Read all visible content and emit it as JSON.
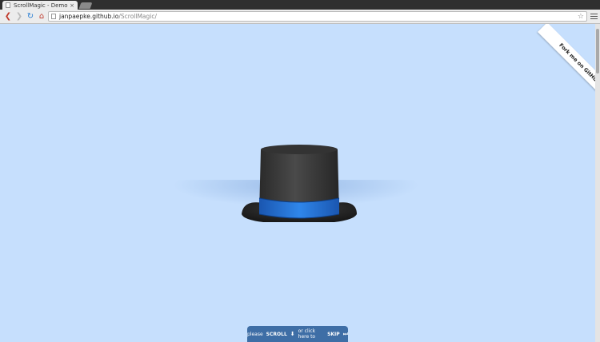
{
  "browser": {
    "tab_title": "ScrollMagic - Demo",
    "tab_close": "×",
    "url_host": "janpaepke.github.io",
    "url_path": "/ScrollMagic/"
  },
  "icons": {
    "back": "back-arrow-icon",
    "forward": "forward-arrow-icon",
    "reload": "reload-icon",
    "home": "home-icon",
    "bookmark": "star-icon",
    "menu": "hamburger-menu-icon"
  },
  "page": {
    "ribbon_text": "Fork me on GitHub",
    "cta": {
      "prefix": "please",
      "scroll": "SCROLL",
      "middle": "or click here to",
      "skip": "SKIP"
    },
    "colors": {
      "background": "#c6dffd",
      "hat_band": "#1f6fd6",
      "hat_body": "#3a3a3a",
      "cta": "#3e6ea6"
    }
  }
}
